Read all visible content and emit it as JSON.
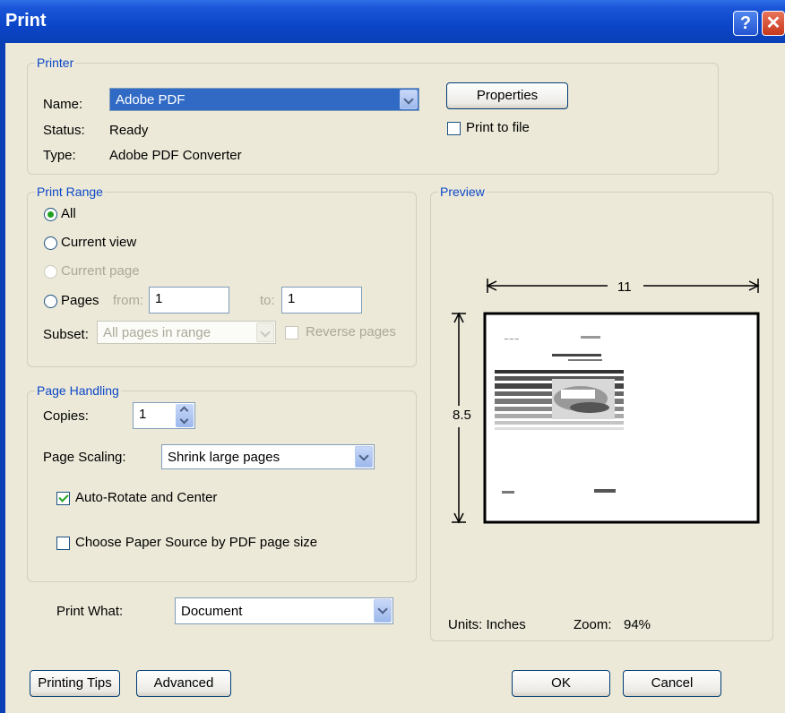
{
  "window": {
    "title": "Print"
  },
  "printer": {
    "legend": "Printer",
    "name_label": "Name:",
    "name_value": "Adobe PDF",
    "status_label": "Status:",
    "status_value": "Ready",
    "type_label": "Type:",
    "type_value": "Adobe PDF Converter",
    "properties_label": "Properties",
    "print_to_file_label": "Print to file",
    "print_to_file_checked": false
  },
  "print_range": {
    "legend": "Print Range",
    "all_label": "All",
    "current_view_label": "Current view",
    "current_page_label": "Current page",
    "pages_label": "Pages",
    "from_label": "from:",
    "from_value": "1",
    "to_label": "to:",
    "to_value": "1",
    "subset_label": "Subset:",
    "subset_value": "All pages in range",
    "reverse_label": "Reverse pages",
    "selected": "All"
  },
  "page_handling": {
    "legend": "Page Handling",
    "copies_label": "Copies:",
    "copies_value": "1",
    "scaling_label": "Page Scaling:",
    "scaling_value": "Shrink large pages",
    "auto_rotate_label": "Auto-Rotate and Center",
    "auto_rotate_checked": true,
    "paper_source_label": "Choose Paper Source by PDF page size",
    "paper_source_checked": false
  },
  "print_what": {
    "label": "Print What:",
    "value": "Document"
  },
  "preview": {
    "legend": "Preview",
    "width": "11",
    "height": "8.5",
    "units_label": "Units: Inches",
    "zoom_label": "Zoom:",
    "zoom_value": "94%"
  },
  "buttons": {
    "printing_tips": "Printing Tips",
    "advanced": "Advanced",
    "ok": "OK",
    "cancel": "Cancel"
  },
  "icons": {
    "help": "help-icon",
    "close": "close-icon"
  },
  "colors": {
    "title_bar": "#0a3fb6",
    "dialog_bg": "#ece9d8",
    "legend_text": "#0c48c8",
    "selection": "#316ac5"
  }
}
